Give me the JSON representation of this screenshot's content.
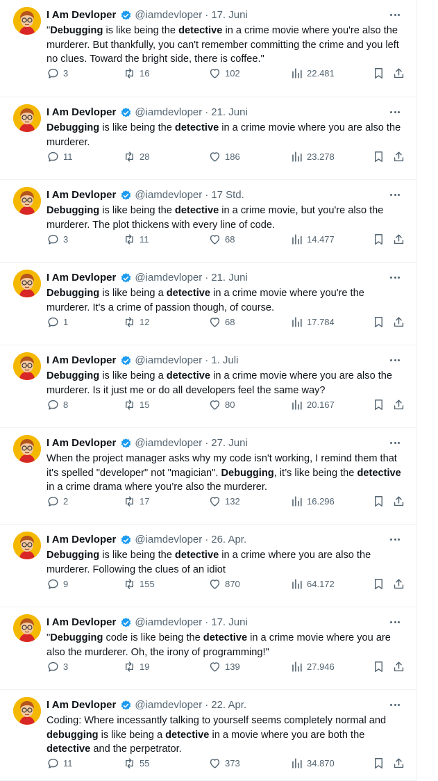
{
  "colors": {
    "accent": "#1d9bf0",
    "muted": "#536471",
    "text": "#0f1419",
    "avatar_bg": "#f5b800"
  },
  "icons": {
    "reply": "speech-bubble-icon",
    "retweet": "retweet-icon",
    "like": "heart-icon",
    "views": "bar-chart-icon",
    "bookmark": "bookmark-icon",
    "share": "share-icon",
    "verified": "verified-badge-icon",
    "more": "more-dots-icon"
  },
  "tweets": [
    {
      "name": "I Am Devloper",
      "handle": "@iamdevloper",
      "sep": "·",
      "date": "17. Juni",
      "text_parts": [
        [
          "t",
          "\""
        ],
        [
          "b",
          "Debugging"
        ],
        [
          "t",
          " is like being the "
        ],
        [
          "b",
          "detective"
        ],
        [
          "t",
          " in a crime movie where you're also the murderer. But thankfully, you can't remember committing the crime and you left no clues. Toward the bright side, there is coffee.\""
        ]
      ],
      "replies": "3",
      "retweets": "16",
      "likes": "102",
      "views": "22.481"
    },
    {
      "name": "I Am Devloper",
      "handle": "@iamdevloper",
      "sep": "·",
      "date": "21. Juni",
      "text_parts": [
        [
          "b",
          "Debugging"
        ],
        [
          "t",
          " is like being the "
        ],
        [
          "b",
          "detective"
        ],
        [
          "t",
          " in a crime movie where you are also the murderer."
        ]
      ],
      "replies": "11",
      "retweets": "28",
      "likes": "186",
      "views": "23.278"
    },
    {
      "name": "I Am Devloper",
      "handle": "@iamdevloper",
      "sep": "·",
      "date": "17 Std.",
      "text_parts": [
        [
          "b",
          "Debugging"
        ],
        [
          "t",
          " is like being the "
        ],
        [
          "b",
          "detective"
        ],
        [
          "t",
          " in a crime movie, but you're also the murderer. The plot thickens with every line of code."
        ]
      ],
      "replies": "3",
      "retweets": "11",
      "likes": "68",
      "views": "14.477"
    },
    {
      "name": "I Am Devloper",
      "handle": "@iamdevloper",
      "sep": "·",
      "date": "21. Juni",
      "text_parts": [
        [
          "b",
          "Debugging"
        ],
        [
          "t",
          " is like being a "
        ],
        [
          "b",
          "detective"
        ],
        [
          "t",
          " in a crime movie where you're the murderer. It's a crime of passion though, of course."
        ]
      ],
      "replies": "1",
      "retweets": "12",
      "likes": "68",
      "views": "17.784"
    },
    {
      "name": "I Am Devloper",
      "handle": "@iamdevloper",
      "sep": "·",
      "date": "1. Juli",
      "text_parts": [
        [
          "b",
          "Debugging"
        ],
        [
          "t",
          " is like being a "
        ],
        [
          "b",
          "detective"
        ],
        [
          "t",
          " in a crime movie where you are also the murderer. Is it just me or do all developers feel the same way?"
        ]
      ],
      "replies": "8",
      "retweets": "15",
      "likes": "80",
      "views": "20.167"
    },
    {
      "name": "I Am Devloper",
      "handle": "@iamdevloper",
      "sep": "·",
      "date": "27. Juni",
      "text_parts": [
        [
          "t",
          "When the project manager asks why my code isn't working, I remind them that it's spelled \"developer\" not \"magician\". "
        ],
        [
          "b",
          "Debugging"
        ],
        [
          "t",
          ", it’s like being the "
        ],
        [
          "b",
          "detective"
        ],
        [
          "t",
          " in a crime drama where you’re also the murderer."
        ]
      ],
      "replies": "2",
      "retweets": "17",
      "likes": "132",
      "views": "16.296"
    },
    {
      "name": "I Am Devloper",
      "handle": "@iamdevloper",
      "sep": "·",
      "date": "26. Apr.",
      "text_parts": [
        [
          "b",
          "Debugging"
        ],
        [
          "t",
          " is like being the "
        ],
        [
          "b",
          "detective"
        ],
        [
          "t",
          " in a crime where you are also the murderer. Following the clues of an idiot"
        ]
      ],
      "replies": "9",
      "retweets": "155",
      "likes": "870",
      "views": "64.172"
    },
    {
      "name": "I Am Devloper",
      "handle": "@iamdevloper",
      "sep": "·",
      "date": "17. Juni",
      "text_parts": [
        [
          "t",
          "\""
        ],
        [
          "b",
          "Debugging"
        ],
        [
          "t",
          " code is like being the "
        ],
        [
          "b",
          "detective"
        ],
        [
          "t",
          " in a crime movie where you are also the murderer. Oh, the irony of programming!\""
        ]
      ],
      "replies": "3",
      "retweets": "19",
      "likes": "139",
      "views": "27.946"
    },
    {
      "name": "I Am Devloper",
      "handle": "@iamdevloper",
      "sep": "·",
      "date": "22. Apr.",
      "text_parts": [
        [
          "t",
          "Coding: Where incessantly talking to yourself seems completely normal and "
        ],
        [
          "b",
          "debugging"
        ],
        [
          "t",
          " is like being a "
        ],
        [
          "b",
          "detective"
        ],
        [
          "t",
          " in a movie where you are both the "
        ],
        [
          "b",
          "detective"
        ],
        [
          "t",
          " and the perpetrator."
        ]
      ],
      "replies": "11",
      "retweets": "55",
      "likes": "373",
      "views": "34.870"
    }
  ]
}
